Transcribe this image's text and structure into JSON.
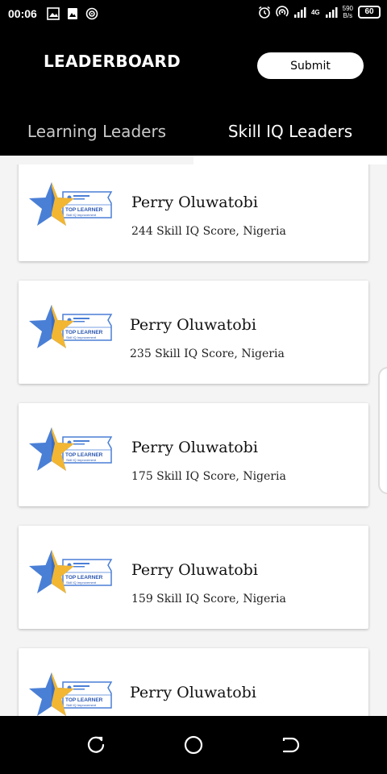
{
  "status_bar": {
    "time": "00:06",
    "network_type": "4G",
    "net_speed_value": "590",
    "net_speed_unit": "B/s",
    "battery": "60",
    "icons": [
      "image-icon",
      "photo-icon",
      "hotspot-icon",
      "alarm-icon",
      "hotspot-icon",
      "signal-icon",
      "signal-icon",
      "battery-icon"
    ]
  },
  "app_bar": {
    "title": "LEADERBOARD",
    "submit_label": "Submit"
  },
  "tabs": [
    {
      "label": "Learning Leaders",
      "active": false
    },
    {
      "label": "Skill IQ Leaders",
      "active": true
    }
  ],
  "badge": {
    "title": "TOP LEARNER",
    "subtitle": "Skill IQ Improvement",
    "icon": "star-badge-icon"
  },
  "leaders": [
    {
      "name": "Perry Oluwatobi",
      "detail": "244 Skill IQ Score, Nigeria"
    },
    {
      "name": "Perry Oluwatobi",
      "detail": "235 Skill IQ Score, Nigeria"
    },
    {
      "name": "Perry Oluwatobi",
      "detail": "175 Skill IQ Score, Nigeria"
    },
    {
      "name": "Perry Oluwatobi",
      "detail": "159 Skill IQ Score, Nigeria"
    },
    {
      "name": "Perry Oluwatobi",
      "detail": ""
    }
  ],
  "nav_bar": {
    "icons": [
      "recents-icon",
      "home-icon",
      "back-icon"
    ]
  },
  "colors": {
    "bar_background": "#000000",
    "star_blue": "#4a7fd6",
    "star_gold": "#f2b632",
    "card": "#ffffff"
  }
}
